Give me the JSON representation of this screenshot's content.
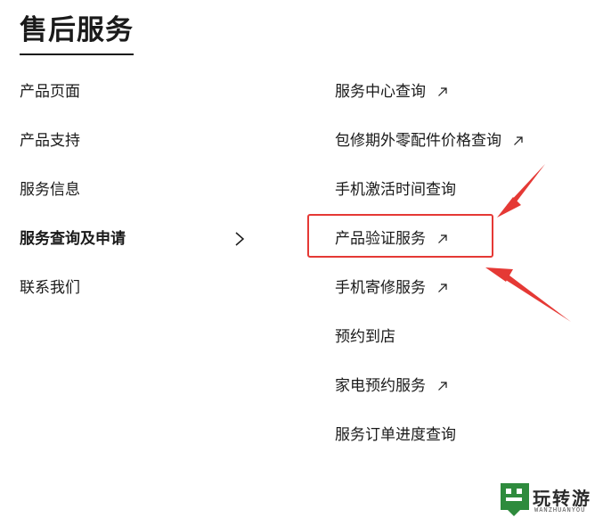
{
  "page": {
    "title": "售后服务"
  },
  "left_menu": [
    {
      "label": "产品页面",
      "active": false
    },
    {
      "label": "产品支持",
      "active": false
    },
    {
      "label": "服务信息",
      "active": false
    },
    {
      "label": "服务查询及申请",
      "active": true
    },
    {
      "label": "联系我们",
      "active": false
    }
  ],
  "right_menu": [
    {
      "label": "服务中心查询",
      "external": true
    },
    {
      "label": "包修期外零配件价格查询",
      "external": true
    },
    {
      "label": "手机激活时间查询",
      "external": false
    },
    {
      "label": "产品验证服务",
      "external": true
    },
    {
      "label": "手机寄修服务",
      "external": true
    },
    {
      "label": "预约到店",
      "external": false
    },
    {
      "label": "家电预约服务",
      "external": true
    },
    {
      "label": "服务订单进度查询",
      "external": false
    }
  ],
  "annotation": {
    "highlight_color": "#e53935",
    "highlighted_item": "产品验证服务"
  },
  "icons": {
    "submenu": "chevron-right-icon",
    "external": "external-link-arrow-icon"
  },
  "watermark": {
    "text": "玩转游",
    "sub": "WANZHUANYOU"
  }
}
